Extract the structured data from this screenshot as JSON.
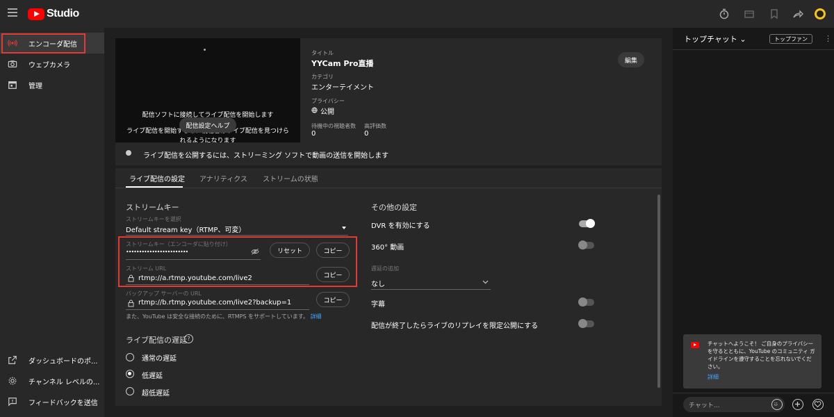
{
  "app": {
    "brand": "Studio"
  },
  "sidebar": {
    "items": [
      {
        "label": "エンコーダ配信",
        "icon": "live-signal-icon"
      },
      {
        "label": "ウェブカメラ",
        "icon": "camera-icon"
      },
      {
        "label": "管理",
        "icon": "calendar-icon"
      }
    ],
    "bottom_items": [
      {
        "label": "ダッシュボードのポ...",
        "icon": "external-link-icon"
      },
      {
        "label": "チャンネル レベルの...",
        "icon": "gear-icon"
      },
      {
        "label": "フィードバックを送信",
        "icon": "feedback-icon"
      }
    ]
  },
  "preview": {
    "message1": "配信ソフトに接続してライブ配信を開始します",
    "message2": "ライブ配信を開始すると、視聴者はライブ配信を見つけられるようになります",
    "help_button": "配信設定ヘルプ"
  },
  "stream_info": {
    "title_label": "タイトル",
    "title": "YYCam Pro直播",
    "category_label": "カテゴリ",
    "category": "エンターテイメント",
    "privacy_label": "プライバシー",
    "privacy": "公開",
    "waiting_viewers_label": "待機中の視聴者数",
    "waiting_viewers": "0",
    "likes_label": "高評価数",
    "likes": "0",
    "edit_button": "編集"
  },
  "status_message": "ライブ配信を公開するには、ストリーミング ソフトで動画の送信を開始します",
  "tabs": [
    "ライブ配信の設定",
    "アナリティクス",
    "ストリームの状態"
  ],
  "stream_key": {
    "section_title": "ストリームキー",
    "select_label": "ストリームキーを選択",
    "selected_key": "Default stream key（RTMP、可変）",
    "key_label": "ストリームキー（エンコーダに貼り付け）",
    "key_value": "••••••••••••••••••••••••",
    "reset_button": "リセット",
    "copy_button": "コピー",
    "url_label": "ストリーム URL",
    "url_value": "rtmp://a.rtmp.youtube.com/live2",
    "backup_label": "バックアップ サーバーの URL",
    "backup_value": "rtmp://b.rtmp.youtube.com/live2?backup=1",
    "footnote": "また、YouTube は安全な接続のために、RTMPS をサポートしています。",
    "footnote_link": "詳細"
  },
  "latency": {
    "title": "ライブ配信の遅延",
    "help": "?",
    "options": [
      "通常の遅延",
      "低遅延",
      "超低遅延"
    ],
    "selected_index": 1
  },
  "other_settings": {
    "title": "その他の設定",
    "dvr_label": "DVR を有効にする",
    "dvr_on": true,
    "video360_label": "360° 動画",
    "video360_on": false,
    "delay_label": "遅延の追加",
    "delay_value": "なし",
    "captions_label": "字幕",
    "captions_on": false,
    "replay_label": "配信が終了したらライブのリプレイを限定公開にする",
    "replay_on": false
  },
  "chat": {
    "title": "トップチャット",
    "top_fan_button": "トップファン",
    "more": "⋮",
    "welcome": "チャットへようこそ！ ご自身のプライバシーを守るとともに、YouTube のコミュニティ ガイドラインを遵守することを忘れないでください。",
    "welcome_link": "詳細",
    "input_placeholder": "チャット..."
  },
  "colors": {
    "accent": "#3ea6ff",
    "highlight": "#e53935",
    "brand": "#ff0000"
  }
}
